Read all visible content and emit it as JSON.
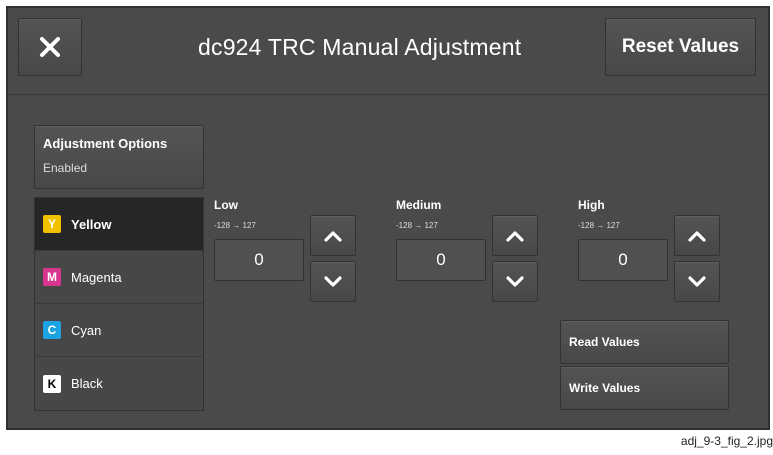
{
  "header": {
    "close_icon": "close-icon",
    "title": "dc924 TRC Manual Adjustment",
    "reset_label": "Reset Values"
  },
  "adjustment_options": {
    "label": "Adjustment Options",
    "value": "Enabled"
  },
  "colors": [
    {
      "letter": "Y",
      "name": "Yellow",
      "swatch": "#f2c200",
      "letter_color": "#ffffff",
      "selected": true
    },
    {
      "letter": "M",
      "name": "Magenta",
      "swatch": "#d8358f",
      "letter_color": "#ffffff",
      "selected": false
    },
    {
      "letter": "C",
      "name": "Cyan",
      "swatch": "#1aa3e0",
      "letter_color": "#ffffff",
      "selected": false
    },
    {
      "letter": "K",
      "name": "Black",
      "swatch": "#ffffff",
      "letter_color": "#000000",
      "selected": false
    }
  ],
  "controls": {
    "low": {
      "label": "Low",
      "range": "-128 → 127",
      "value": "0"
    },
    "medium": {
      "label": "Medium",
      "range": "-128 → 127",
      "value": "0"
    },
    "high": {
      "label": "High",
      "range": "-128 → 127",
      "value": "0"
    }
  },
  "actions": {
    "read_label": "Read Values",
    "write_label": "Write Values"
  },
  "caption": "adj_9-3_fig_2.jpg",
  "icons": {
    "up": "chevron-up-icon",
    "down": "chevron-down-icon"
  }
}
